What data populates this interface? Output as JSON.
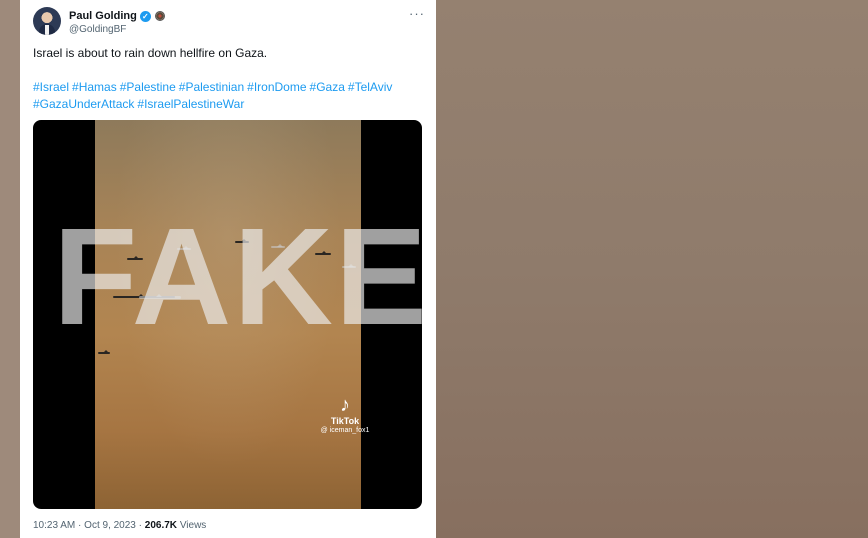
{
  "tweet": {
    "author_name": "Paul Golding",
    "author_handle": "@GoldingBF",
    "more_label": "···",
    "text": "Israel is about to rain down hellfire on Gaza.",
    "hashtags_line1": [
      "#Israel",
      "#Hamas",
      "#Palestine",
      "#Palestinian",
      "#IronDome",
      "#Gaza",
      "#TelAviv"
    ],
    "hashtags_line2": [
      "#GazaUnderAttack",
      "#IsraelPalestineWar"
    ],
    "media": {
      "overlay_text": "FAKE",
      "watermark_brand": "TikTok",
      "watermark_user": "@ iceman_fox1",
      "watermark_icon": "tiktok-icon"
    },
    "time": "10:23 AM",
    "date": "Oct 9, 2023",
    "views_count": "206.7K",
    "views_label": "Views",
    "separator": "·"
  },
  "icons": {
    "verified": "verified-check-icon",
    "more": "more-options-icon"
  },
  "colors": {
    "link": "#1d9bf0",
    "text": "#0f1419",
    "muted": "#536471",
    "verified": "#1d9bf0"
  }
}
